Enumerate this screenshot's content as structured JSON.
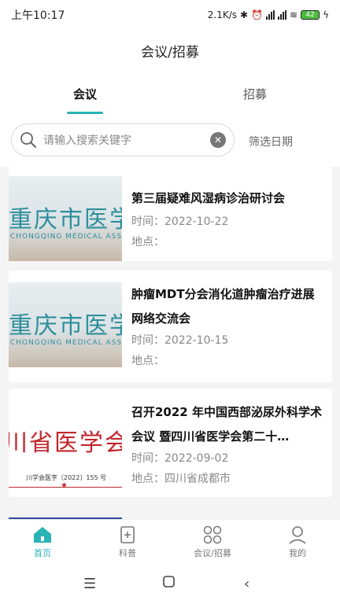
{
  "status": {
    "time": "上午10:17",
    "speed": "2.1K/s",
    "battery": "42"
  },
  "header": {
    "title": "会议/招募"
  },
  "tabs": [
    {
      "label": "会议",
      "active": true
    },
    {
      "label": "招募",
      "active": false
    }
  ],
  "search": {
    "placeholder": "请输入搜索关键字",
    "filter_label": "筛选日期"
  },
  "cards": [
    {
      "title": "第三届疑难风湿病诊治研讨会",
      "time": "时间：2022-10-22",
      "place": "地点：",
      "thumb_big": "重庆市医学",
      "thumb_small": "CHONGQING MEDICAL ASS"
    },
    {
      "title": "肿瘤MDT分会消化道肿瘤治疗进展网络交流会",
      "time": "时间：2022-10-15",
      "place": "地点：",
      "thumb_big": "重庆市医学",
      "thumb_small": "CHONGQING MEDICAL ASS"
    },
    {
      "title": "召开2022 年中国西部泌尿外科学术会议 暨四川省医学会第二十…",
      "time": "时间：2022-09-02",
      "place": "地点：四川省成都市",
      "thumb_big": "川省医学会文",
      "thumb_small": "川学会医字〔2022〕155 号"
    }
  ],
  "nav": [
    {
      "label": "首页",
      "icon": "home-icon",
      "active": true
    },
    {
      "label": "科普",
      "icon": "book-icon",
      "active": false
    },
    {
      "label": "会议/招募",
      "icon": "grid-circles-icon",
      "active": false
    },
    {
      "label": "我的",
      "icon": "user-icon",
      "active": false
    }
  ],
  "colors": {
    "accent": "#2ab3b5",
    "background": "#f4f4f4"
  }
}
